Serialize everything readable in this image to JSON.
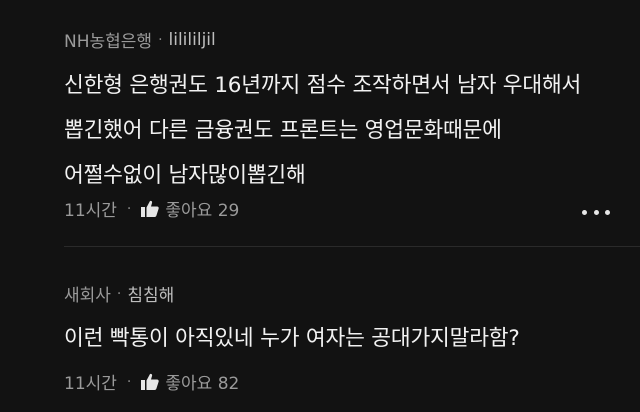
{
  "comments": [
    {
      "source": "NH농협은행",
      "nickname": "lilililjil",
      "body_lines": [
        "신한형 은행권도 16년까지 점수 조작하면서 남자 우대해서",
        "뽑긴했어 다른 금융권도 프론트는 영업문화때문에",
        "어쩔수없이 남자많이뽑긴해"
      ],
      "time": "11시간",
      "like_label": "좋아요 29"
    },
    {
      "source": "새회사",
      "nickname": "침침해",
      "body_lines": [
        "이런 빡통이 아직있네 누가 여자는 공대가지말라함?"
      ],
      "time": "11시간",
      "like_label": "좋아요 82"
    }
  ],
  "separators": {
    "meta": "·",
    "action": "·"
  },
  "icons": {
    "like": "thumbs-up-icon",
    "more": "more-dots-icon"
  },
  "colors": {
    "background": "#121212",
    "text": "#f2f2f2",
    "muted": "#9a9a9a"
  }
}
